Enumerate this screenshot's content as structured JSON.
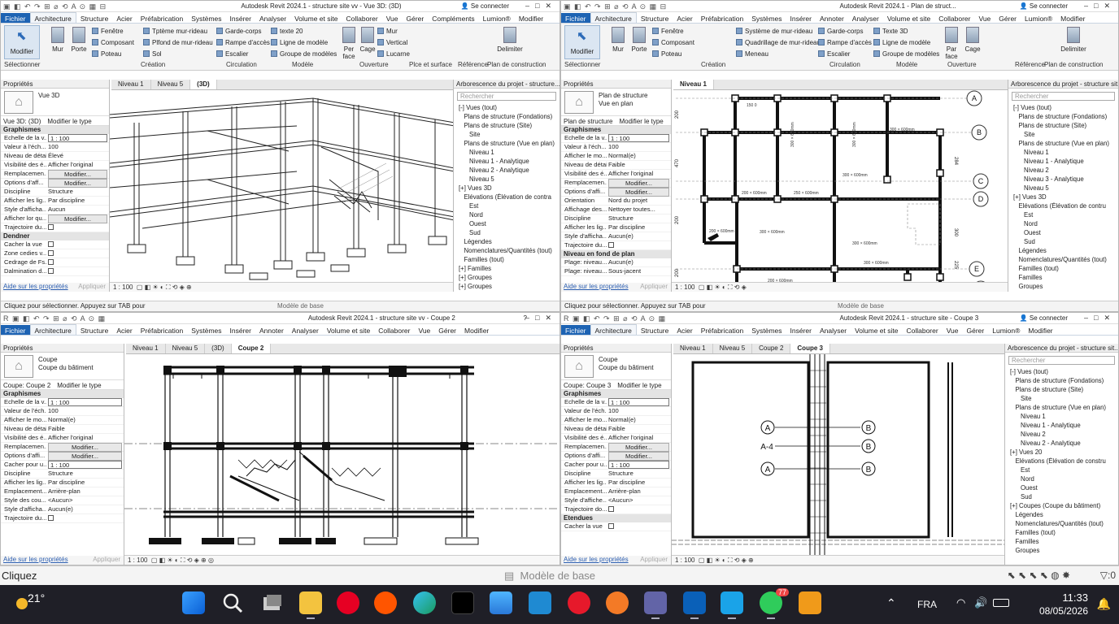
{
  "desktop_status": {
    "left": "Cliquez",
    "model": "Modèle de base",
    "filter_count": ":0"
  },
  "taskbar": {
    "weather_temp": "21°",
    "lang": "FRA",
    "time": "11:33",
    "date": "08/05/2026",
    "badge_count": "77",
    "apps": [
      "start-icon",
      "search-icon",
      "task-view-icon",
      "file-explorer-icon",
      "pinterest-icon",
      "soundcloud-icon",
      "edge-icon",
      "tiktok-icon",
      "store-icon",
      "vscode-icon",
      "opera-icon",
      "brave-icon",
      "teams-icon",
      "revit-icon",
      "blue-app-icon",
      "whatsapp-icon",
      "orange-app-icon"
    ]
  },
  "windows": [
    {
      "id": "w1",
      "title": "Autodesk Revit 2024.1 - structure site vv - Vue 3D: (3D)",
      "sign_in": "Se connecter",
      "menu": [
        "Fichier",
        "Architecture",
        "Structure",
        "Acier",
        "Préfabrication",
        "Systèmes",
        "Insérer",
        "Analyser",
        "Volume et site",
        "Collaborer",
        "Vue",
        "Gérer",
        "Compléments",
        "Lumion®",
        "Modifier"
      ],
      "ribbon": {
        "modify": "Modifier",
        "big": [
          "Mur",
          "Porte"
        ],
        "col1": [
          "Fenêtre",
          "Composant",
          "Poteau"
        ],
        "col2": [
          "Tptème mur-rideau",
          "Plfond de mur-rideau",
          "Sol"
        ],
        "col3": [
          "Garde-corps",
          "Rampe d'accès",
          "Escalier"
        ],
        "col4": [
          "texte 20",
          "Ligne de modèle",
          "Groupe de modèles"
        ],
        "col5": [
          "Mur",
          "Vertical",
          "Lucarne"
        ],
        "face": "Per face",
        "cage": "Cage",
        "delim": "Delimiter",
        "groups": [
          "Sélectionner",
          "Création",
          "Circulation",
          "Modèle",
          "Ouverture",
          "Plce et surface",
          "Référence",
          "Plan de construction"
        ]
      },
      "props": {
        "header": "Propriétés",
        "type": "Vue 3D",
        "instance": "Vue 3D: (3D)",
        "edit_type": "Modifier le type",
        "group": "Graphismes",
        "rows": [
          [
            "Echelle de la v...",
            "1 : 100"
          ],
          [
            "Valeur à l'éch...",
            "100"
          ],
          [
            "Niveau de détail",
            "Élevé"
          ],
          [
            "Visibilité des é...",
            "Afficher l'original"
          ],
          [
            "Remplacemen...",
            "Modifier..."
          ],
          [
            "Options d'aff...",
            "Modifier..."
          ],
          [
            "Discipline",
            "Structure"
          ],
          [
            "Afficher les lig...",
            "Par discipline"
          ],
          [
            "Style d'afficha...",
            "Aucun"
          ],
          [
            "Afficher lor qu...",
            "Modifier..."
          ],
          [
            "Trajectoire du...",
            ""
          ]
        ],
        "group2": "Dendner",
        "rows2": [
          [
            "Cacher la vue",
            ""
          ],
          [
            "Zone cedies v...",
            ""
          ],
          [
            "Cedrage de Fs...",
            ""
          ],
          [
            "Dalmination d...",
            ""
          ]
        ],
        "help": "Aide sur les propriétés",
        "apply": "Appliquer"
      },
      "tabs": [
        "Niveau 1",
        "Niveau 5",
        "(3D)"
      ],
      "viewbar": "1 : 100",
      "browser": {
        "header": "Arborescence du projet - structure...",
        "search": "Rechercher",
        "items": [
          "[-] Vues (tout)",
          "   Plans de structure (Fondations)",
          "   Plans de structure (Site)",
          "      Site",
          "   Plans de structure (Vue en plan)",
          "      Niveau 1",
          "      Niveau 1 - Analytique",
          "      Niveau 2 - Analytique",
          "      Niveau 5",
          "[+] Vues 3D",
          "   Elévations (Élévation de contra",
          "      Est",
          "      Nord",
          "      Ouest",
          "      Sud",
          "   Légendes",
          "   Nomenclatures/Quantités (tout)",
          "   Familles (tout)",
          "[+] Familles",
          "[+] Groupes",
          "[+] Groupes"
        ]
      },
      "status": "Cliquez pour sélectionner. Appuyez sur TAB pour"
    },
    {
      "id": "w2",
      "title": "Autodesk Revit 2024.1 - Plan de struct...",
      "sign_in": "Se connecter",
      "menu": [
        "Fichier",
        "Architecture",
        "Structure",
        "Acier",
        "Préfabrication",
        "Systèmes",
        "Insérer",
        "Annoter",
        "Analyser",
        "Volume et site",
        "Collaborer",
        "Vue",
        "Gérer",
        "Lumion®",
        "Modifier"
      ],
      "ribbon": {
        "modify": "Modifier",
        "big": [
          "Mur",
          "Porte"
        ],
        "col1": [
          "Fenêtre",
          "Composant",
          "Poteau"
        ],
        "col2": [
          "Système de mur-rideau",
          "Quadrillage de mur-rideau",
          "Meneau"
        ],
        "col3": [
          "Garde-corps",
          "Rampe d'accès",
          "Escalier"
        ],
        "col4": [
          "Texte 3D",
          "Ligne de modèle",
          "Groupe de modèles"
        ],
        "col5": [
          "Mur",
          "Vertical",
          "Lucarne"
        ],
        "face": "Par face",
        "cage": "Cage",
        "delim": "Delimiter",
        "groups": [
          "Sélectionner",
          "Création",
          "Circulation",
          "Modèle",
          "Ouverture",
          "Pièce et surface",
          "Référence",
          "Plan de construction"
        ]
      },
      "props": {
        "header": "Propriétés",
        "type": "Plan de structure",
        "type2": "Vue en plan",
        "instance": "Plan de structure",
        "edit_type": "Modifier le type",
        "group": "Graphismes",
        "rows": [
          [
            "Echelle de la v...",
            "1 : 100"
          ],
          [
            "Valeur à l'éch...",
            "100"
          ],
          [
            "Afficher le mo...",
            "Normal(e)"
          ],
          [
            "Niveau de détail",
            "Faible"
          ],
          [
            "Visibilité des é...",
            "Afficher l'original"
          ],
          [
            "Remplacemen...",
            "Modifier..."
          ],
          [
            "Options d'affi...",
            "Modifier..."
          ],
          [
            "Orientation",
            "Nord du projet"
          ],
          [
            "Affichage des...",
            "Nettoyer toutes..."
          ],
          [
            "Discipline",
            "Structure"
          ],
          [
            "Afficher les lig...",
            "Par discipline"
          ],
          [
            "Style d'afficha...",
            "Aucun(e)"
          ],
          [
            "Trajectoire du...",
            ""
          ]
        ],
        "group2": "Niveau en fond de plan",
        "rows2": [
          [
            "Plage: niveau...",
            "Aucun(e)"
          ],
          [
            "Plage: niveau...",
            "Sous-jacent"
          ]
        ],
        "help": "Aide sur les propriétés",
        "apply": "Appliquer"
      },
      "tabs": [
        "Niveau 1"
      ],
      "viewbar": "1 : 100",
      "browser": {
        "header": "Arborescence du projet - structure sit...",
        "search": "Rechercher",
        "items": [
          "[-] Vues (tout)",
          "   Plans de structure (Fondations)",
          "   Plans de structure (Site)",
          "      Site",
          "   Plans de structure (Vue en plan)",
          "      Niveau 1",
          "      Niveau 1 - Analytique",
          "      Niveau 2",
          "      Niveau 3 - Analytique",
          "      Niveau 5",
          "[+] Vues 3D",
          "   Elévations (Élévation de contru",
          "      Est",
          "      Nord",
          "      Ouest",
          "      Sud",
          "   Légendes",
          "   Nomenclatures/Quantités (tout)",
          "   Familles (tout)",
          "   Familles",
          "   Groupes"
        ]
      },
      "status": "Cliquez pour sélectionner. Appuyez sur TAB pour"
    },
    {
      "id": "w3",
      "title": "Autodesk Revit 2024.1 - structure site vv - Coupe 2",
      "sign_in": "Se connecter",
      "menu": [
        "Fichier",
        "Architecture",
        "Structure",
        "Acier",
        "Préfabrication",
        "Systèmes",
        "Insérer",
        "Annoter",
        "Analyser",
        "Volume et site",
        "Collaborer",
        "Vue",
        "Gérer",
        "Modifier"
      ],
      "props": {
        "header": "Propriétés",
        "type": "Coupe",
        "type2": "Coupe du bâtiment",
        "instance": "Coupe: Coupe 2",
        "edit_type": "Modifier le type",
        "group": "Graphismes",
        "rows": [
          [
            "Echelle de la v...",
            "1 : 100"
          ],
          [
            "Valeur de l'éch...",
            "100"
          ],
          [
            "Afficher le mo...",
            "Normal(e)"
          ],
          [
            "Niveau de détail",
            "Faible"
          ],
          [
            "Visibilité des é...",
            "Afficher l'original"
          ],
          [
            "Remplacemen...",
            "Modifier..."
          ],
          [
            "Options d'affi...",
            "Modifier..."
          ],
          [
            "Cacher pour u...",
            "1 : 100"
          ],
          [
            "Discipline",
            "Structure"
          ],
          [
            "Afficher les lig...",
            "Par discipline"
          ],
          [
            "Emplacement...",
            "Arrière-plan"
          ],
          [
            "Style des cou...",
            "<Aucun>"
          ],
          [
            "Style d'afficha...",
            "Aucun(e)"
          ],
          [
            "Trajectoire du...",
            ""
          ]
        ],
        "help": "Aide sur les propriétés",
        "apply": "Appliquer"
      },
      "tabs": [
        "Niveau 1",
        "Niveau 5",
        "(3D)",
        "Coupe 2"
      ],
      "viewbar": "1 : 100"
    },
    {
      "id": "w4",
      "title": "Autodesk Revit 2024.1 - structure site - Coupe 3",
      "sign_in": "Se connecter",
      "menu": [
        "Fichier",
        "Architecture",
        "Structure",
        "Acier",
        "Préfabrication",
        "Systèmes",
        "Insérer",
        "Analyser",
        "Volume et site",
        "Collaborer",
        "Vue",
        "Gérer",
        "Lumion®",
        "Modifier"
      ],
      "props": {
        "header": "Propriétés",
        "type": "Coupe",
        "type2": "Coupe du bâtiment",
        "instance": "Coupe: Coupe 3",
        "edit_type": "Modifier le type",
        "group": "Graphismes",
        "rows": [
          [
            "Echelle de la v...",
            "1 : 100"
          ],
          [
            "Valeur de l'éch...",
            "100"
          ],
          [
            "Afficher le mo...",
            "Normal(e)"
          ],
          [
            "Niveau de détail",
            "Faible"
          ],
          [
            "Visibilité des é...",
            "Afficher l'original"
          ],
          [
            "Remplacemen...",
            "Modifier..."
          ],
          [
            "Options d'affi...",
            "Modifier..."
          ],
          [
            "Cacher pour u...",
            "1 : 100"
          ],
          [
            "Discipline",
            "Structure"
          ],
          [
            "Afficher les lig...",
            "Par discipline"
          ],
          [
            "Emplacement...",
            "Arrière-plan"
          ],
          [
            "Style d'affiche...",
            "<Aucun>"
          ],
          [
            "Trajectoire do...",
            ""
          ]
        ],
        "group2": "Etendues",
        "rows2": [
          [
            "Cacher la vue",
            ""
          ]
        ],
        "help": "Aide sur les propriétés",
        "apply": "Appliquer"
      },
      "tabs": [
        "Niveau 1",
        "Niveau 5",
        "Coupe 2",
        "Coupe 3"
      ],
      "viewbar": "1 : 100",
      "grid_labels": [
        "A",
        "A-4",
        "A",
        "B",
        "B",
        "B"
      ],
      "browser": {
        "header": "Arborescence du projet - structure sit...",
        "search": "Rechercher",
        "items": [
          "[-] Vues (tout)",
          "   Plans de structure (Fondations)",
          "   Plans de structure (Site)",
          "      Site",
          "   Plans de structure (Vue en plan)",
          "      Niveau 1",
          "      Niveau 1 - Analytique",
          "      Niveau 2",
          "      Niveau 2 - Analytique",
          "[+] Vues 20",
          "   Elévations (Élévation de constru",
          "      Est",
          "      Nord",
          "      Ouest",
          "      Sud",
          "[+] Coupes (Coupe du bâtiment)",
          "   Légendes",
          "   Nomenclatures/Quantités (tout)",
          "   Familles (tout)",
          "   Familles",
          "   Groupes"
        ]
      }
    }
  ],
  "plan_labels": [
    "200 × 600mm",
    "200 × 600mm",
    "300 × 600mm",
    "300 × 600mm",
    "200 × 600mm",
    "300 × 600mm",
    "200 × 600mm"
  ],
  "plan_dims": [
    "200",
    "470",
    "200",
    "200",
    "284",
    "300",
    "225"
  ],
  "plan_grid": [
    "A",
    "B",
    "C",
    "D",
    "E",
    "F"
  ]
}
